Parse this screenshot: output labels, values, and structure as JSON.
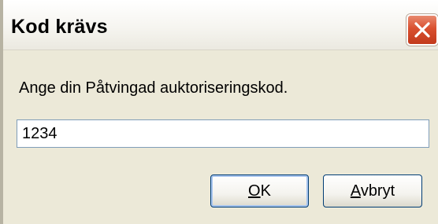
{
  "window": {
    "title": "Kod krävs",
    "close_icon": "close-icon"
  },
  "prompt": {
    "text": "Ange din Påtvingad auktoriseringskod."
  },
  "input": {
    "value": "1234",
    "placeholder": ""
  },
  "buttons": {
    "ok": {
      "mnemonic": "O",
      "rest": "K"
    },
    "cancel": {
      "mnemonic": "A",
      "rest": "vbryt"
    }
  },
  "colors": {
    "dialog_bg": "#ece9d8",
    "close_button": "#d9502f",
    "button_border": "#003c74",
    "input_border": "#7f9db9"
  }
}
